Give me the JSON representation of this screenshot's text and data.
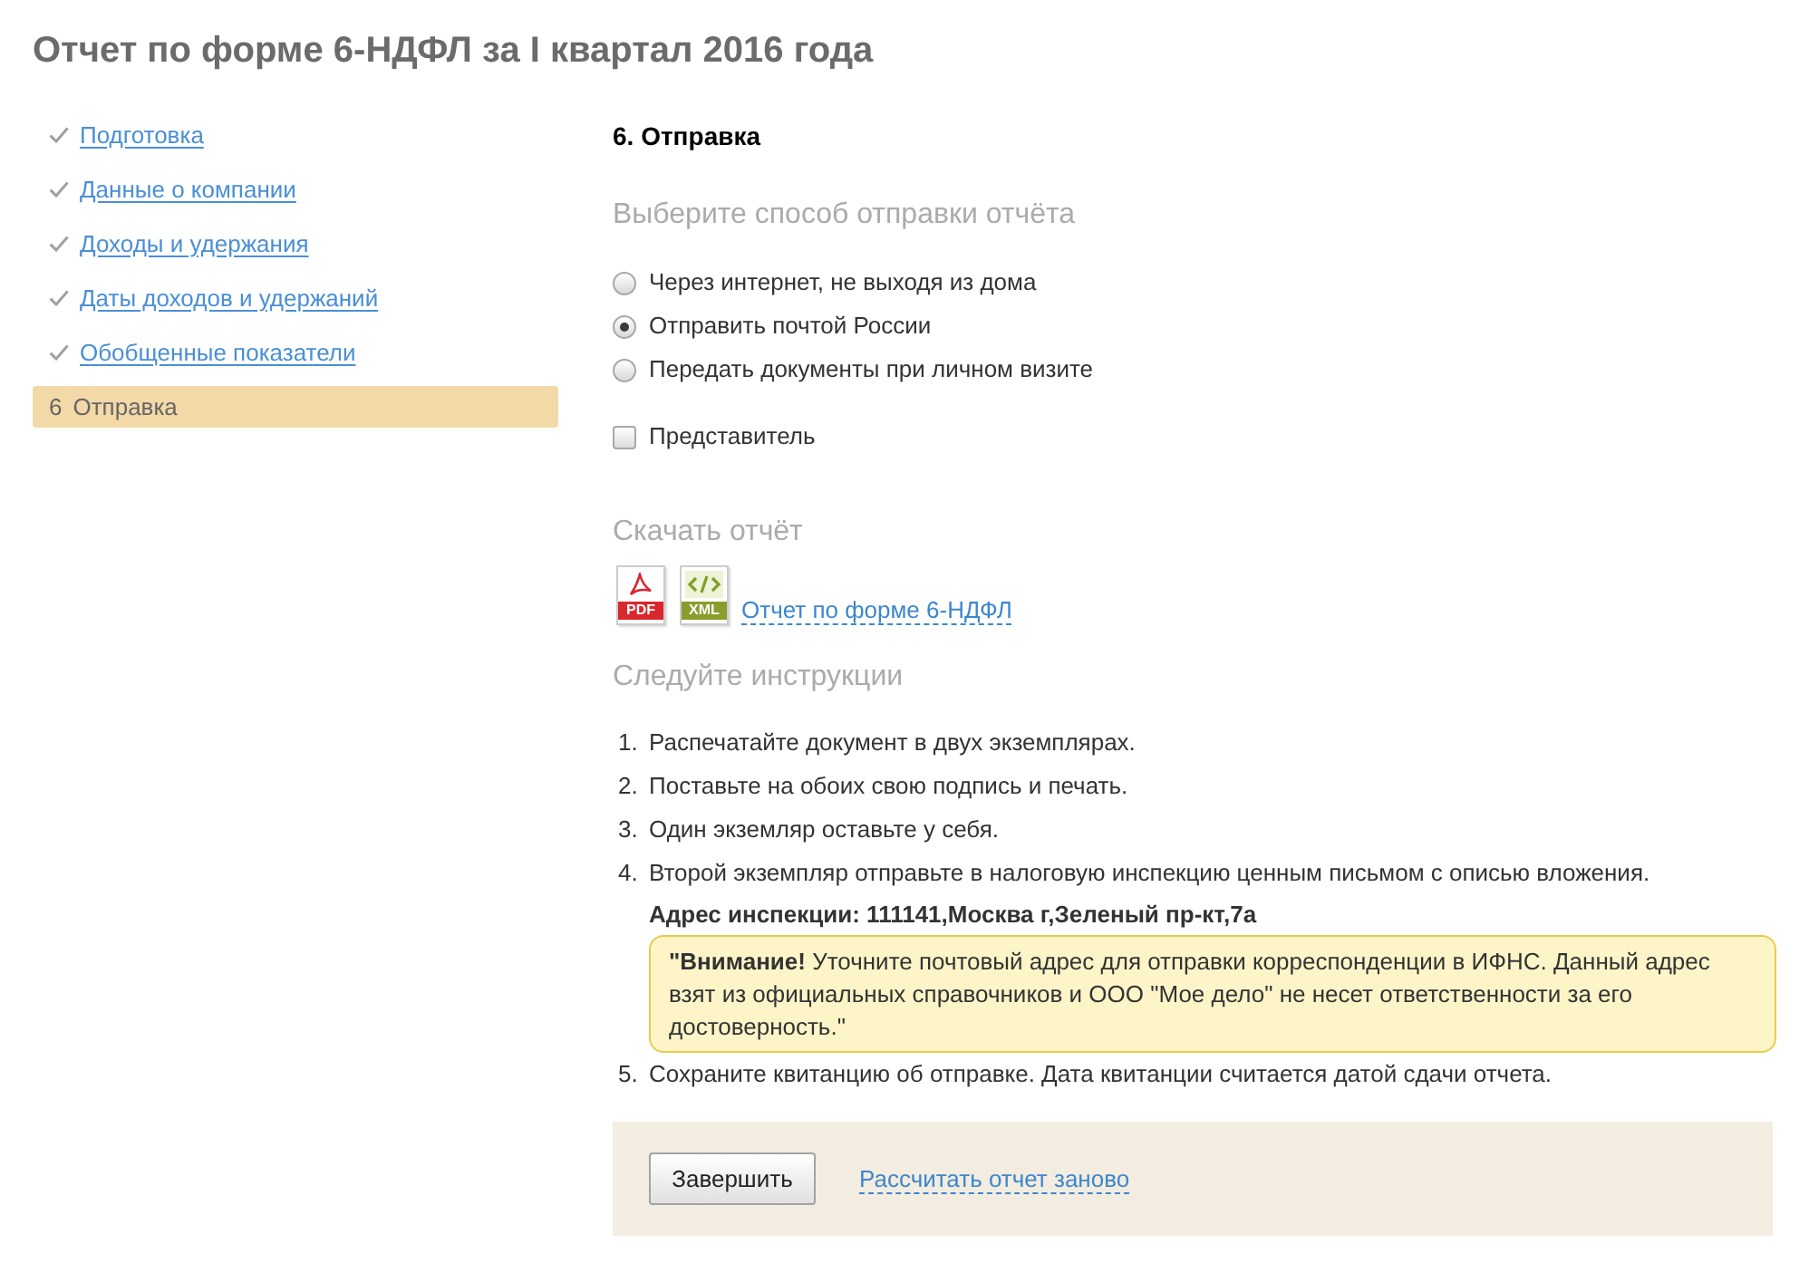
{
  "page": {
    "title": "Отчет по форме 6-НДФЛ за I квартал 2016 года"
  },
  "sidebar": {
    "items": [
      {
        "kind": "done",
        "label": "Подготовка",
        "selected": false
      },
      {
        "kind": "done",
        "label": "Данные о компании",
        "selected": false
      },
      {
        "kind": "done",
        "label": "Доходы и удержания",
        "selected": false
      },
      {
        "kind": "done",
        "label": "Даты доходов и удержаний",
        "selected": false
      },
      {
        "kind": "done",
        "label": "Обобщенные показатели",
        "selected": false
      },
      {
        "kind": "step",
        "number": "6",
        "label": "Отправка",
        "selected": true
      }
    ]
  },
  "main": {
    "heading": "6. Отправка",
    "send_method": {
      "title": "Выберите способ отправки отчёта",
      "options": [
        {
          "label": "Через интернет, не выходя из дома",
          "selected": false
        },
        {
          "label": "Отправить почтой России",
          "selected": true
        },
        {
          "label": "Передать документы при личном визите",
          "selected": false
        }
      ]
    },
    "representative": {
      "label": "Представитель",
      "checked": false
    },
    "download": {
      "title": "Скачать отчёт",
      "files": [
        {
          "kind": "pdf",
          "label": "PDF"
        },
        {
          "kind": "xml",
          "label": "XML"
        }
      ],
      "link": "Отчет по форме 6-НДФЛ"
    },
    "instructions": {
      "title": "Следуйте инструкции",
      "steps": [
        {
          "number": "1.",
          "text": "Распечатайте документ в двух экземплярах."
        },
        {
          "number": "2.",
          "text": "Поставьте на обоих свою подпись и печать."
        },
        {
          "number": "3.",
          "text": "Один экземляр оставьте у себя."
        },
        {
          "number": "4.",
          "text": "Второй экземпляр отправьте в налоговую инспекцию ценным письмом с описью вложения.",
          "address": "Адрес инспекции: 111141,Москва г,Зеленый пр-кт,7а",
          "warning": "**\"Внимание!** Уточните почтовый адрес для отправки корреспонденции в ИФНС. Данный адрес взят из официальных справочников и ООО \"Мое дело\" не несет ответственности за его достоверность.\""
        },
        {
          "number": "5.",
          "text": "Сохраните квитанцию об отправке. Дата квитанции считается датой сдачи отчета."
        }
      ]
    },
    "actions": {
      "button": "Завершить",
      "link": "Рассчитать отчет заново"
    }
  }
}
